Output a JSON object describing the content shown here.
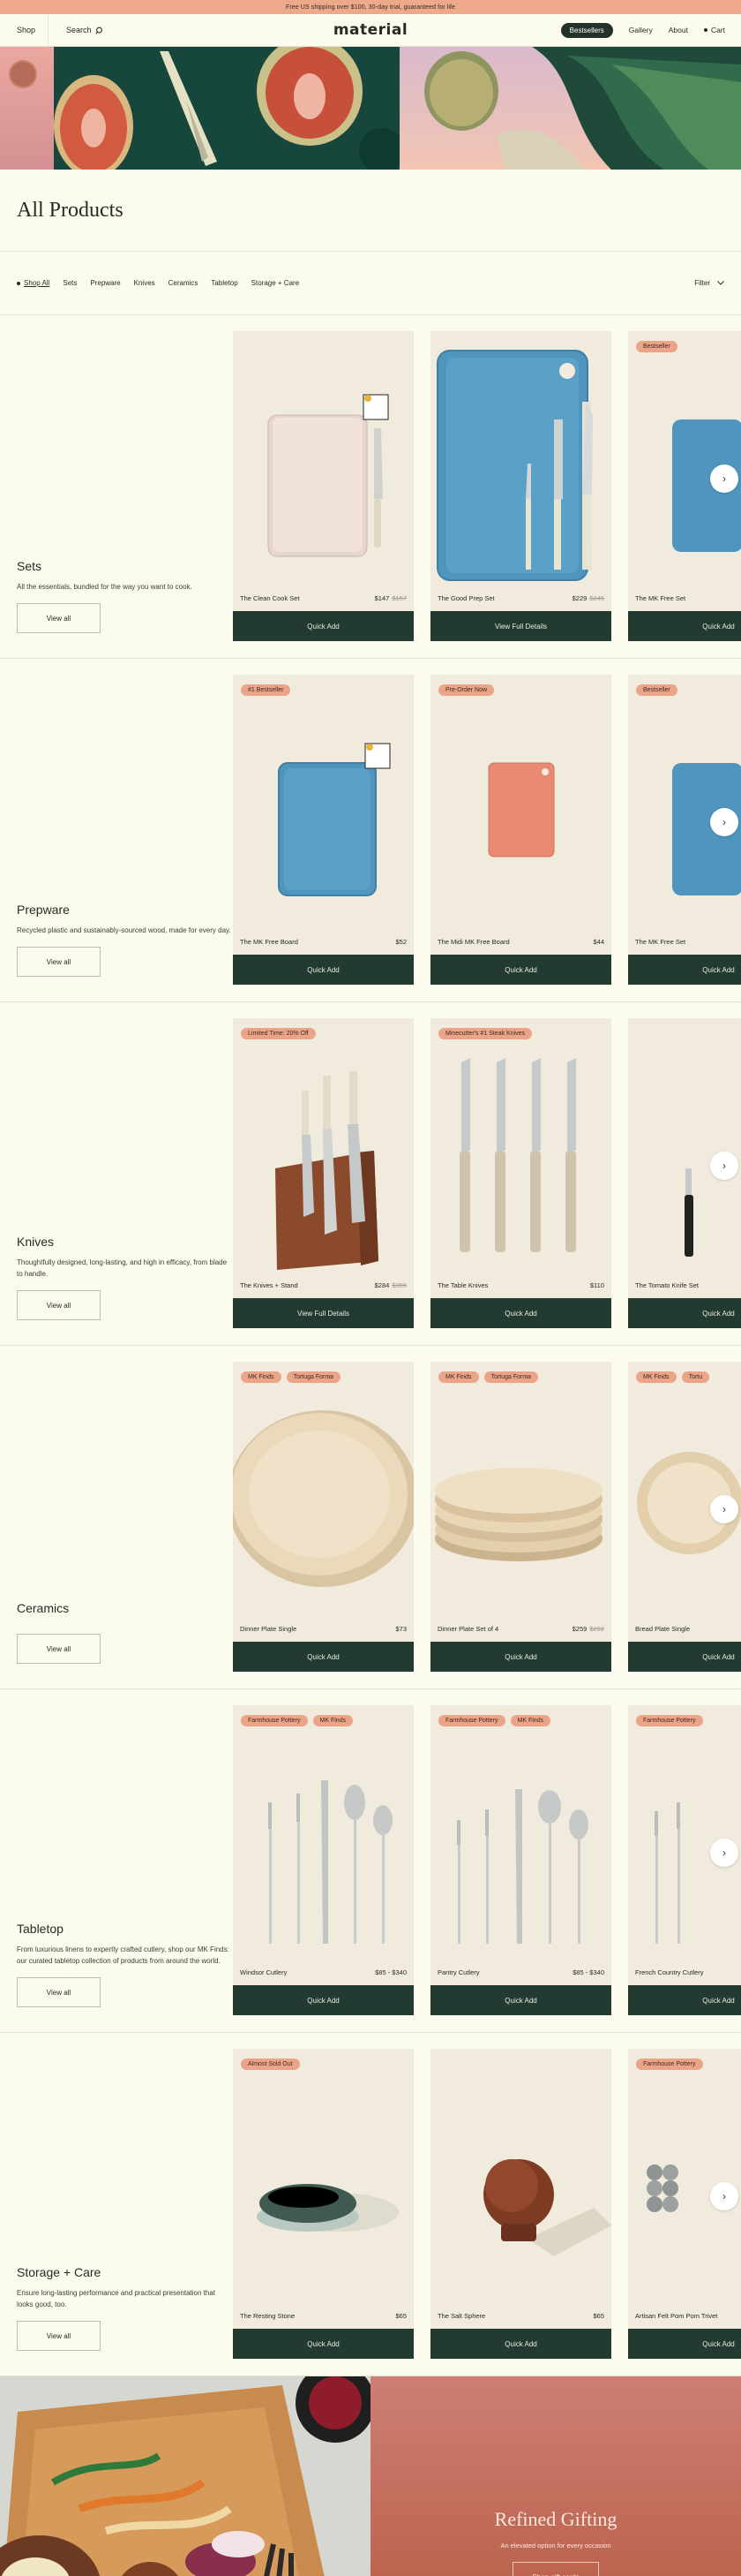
{
  "announcement": "Free US shipping over $100, 30-day trial, guaranteed for life",
  "nav": {
    "shop": "Shop",
    "search": "Search",
    "logo": "material",
    "bestsellers": "Bestsellers",
    "gallery": "Gallery",
    "about": "About",
    "cart": "Cart"
  },
  "page_title": "All Products",
  "filters": {
    "items": [
      "Shop All",
      "Sets",
      "Prepware",
      "Knives",
      "Ceramics",
      "Tabletop",
      "Storage + Care"
    ],
    "filter_label": "Filter"
  },
  "sections": [
    {
      "title": "Sets",
      "description": "All the essentials, bundled for the way you want to cook.",
      "view_all": "View all",
      "products": [
        {
          "name": "The Clean Cook Set",
          "price": "$147",
          "old_price": "$157",
          "badges": [],
          "button": "Quick Add"
        },
        {
          "name": "The Good Prep Set",
          "price": "$229",
          "old_price": "$245",
          "badges": [],
          "button": "View Full Details"
        },
        {
          "name": "The MK Free Set",
          "price": "",
          "old_price": "",
          "badges": [
            "Bestseller"
          ],
          "button": "Quick Add"
        }
      ]
    },
    {
      "title": "Prepware",
      "description": "Recycled plastic and sustainably-sourced wood, made for every day.",
      "view_all": "View all",
      "products": [
        {
          "name": "The MK Free Board",
          "price": "$52",
          "old_price": "",
          "badges": [
            "#1 Bestseller"
          ],
          "button": "Quick Add"
        },
        {
          "name": "The Midi MK Free Board",
          "price": "$44",
          "old_price": "",
          "badges": [
            "Pre-Order Now"
          ],
          "button": "Quick Add"
        },
        {
          "name": "The MK Free Set",
          "price": "",
          "old_price": "",
          "badges": [
            "Bestseller"
          ],
          "button": "Quick Add"
        }
      ]
    },
    {
      "title": "Knives",
      "description": "Thoughtfully designed, long-lasting, and high in efficacy, from blade to handle.",
      "view_all": "View all",
      "products": [
        {
          "name": "The Knives + Stand",
          "price": "$284",
          "old_price": "$355",
          "badges": [
            "Limited Time: 20% Off"
          ],
          "button": "View Full Details"
        },
        {
          "name": "The Table Knives",
          "price": "$110",
          "old_price": "",
          "badges": [
            "Minecutter's #1 Steak Knives"
          ],
          "button": "Quick Add"
        },
        {
          "name": "The Tomato Knife Set",
          "price": "",
          "old_price": "",
          "badges": [],
          "button": "Quick Add"
        }
      ]
    },
    {
      "title": "Ceramics",
      "description": "",
      "view_all": "View all",
      "products": [
        {
          "name": "Dinner Plate Single",
          "price": "$73",
          "old_price": "",
          "badges": [
            "MK Finds",
            "Tortuga Forma"
          ],
          "button": "Quick Add"
        },
        {
          "name": "Dinner Plate Set of 4",
          "price": "$259",
          "old_price": "$292",
          "badges": [
            "MK Finds",
            "Tortuga Forma"
          ],
          "button": "Quick Add"
        },
        {
          "name": "Bread Plate Single",
          "price": "",
          "old_price": "",
          "badges": [
            "MK Finds",
            "Tortu"
          ],
          "button": "Quick Add"
        }
      ]
    },
    {
      "title": "Tabletop",
      "description": "From luxurious linens to expertly crafted cutlery, shop our MK Finds: our curated tabletop collection of products from around the world.",
      "view_all": "View all",
      "products": [
        {
          "name": "Windsor Cutlery",
          "price": "$85 - $340",
          "old_price": "",
          "badges": [
            "Farmhouse Pottery",
            "MK Finds"
          ],
          "button": "Quick Add"
        },
        {
          "name": "Pantry Cutlery",
          "price": "$85 - $340",
          "old_price": "",
          "badges": [
            "Farmhouse Pottery",
            "MK Finds"
          ],
          "button": "Quick Add"
        },
        {
          "name": "French Country Cutlery",
          "price": "",
          "old_price": "",
          "badges": [
            "Farmhouse Pottery"
          ],
          "button": "Quick Add"
        }
      ]
    },
    {
      "title": "Storage + Care",
      "description": "Ensure long-lasting performance and practical presentation that looks good, too.",
      "view_all": "View all",
      "products": [
        {
          "name": "The Resting Stone",
          "price": "$65",
          "old_price": "",
          "badges": [
            "Almost Sold Out"
          ],
          "button": "Quick Add"
        },
        {
          "name": "The Salt Sphere",
          "price": "$65",
          "old_price": "",
          "badges": [],
          "button": "Quick Add"
        },
        {
          "name": "Artisan Felt Pom Pom Trivet",
          "price": "",
          "old_price": "",
          "badges": [
            "Farmhouse Pottery"
          ],
          "button": "Quick Add"
        }
      ]
    }
  ],
  "gifting": {
    "title": "Refined Gifting",
    "subtitle": "An elevated option for every occasion",
    "button": "Shop gift cards"
  },
  "colors": {
    "background": "#fbfbee",
    "announcement": "#eea98a",
    "button_dark": "#233a31",
    "badge": "#eca489",
    "gift_panel": "#c26c5b"
  }
}
